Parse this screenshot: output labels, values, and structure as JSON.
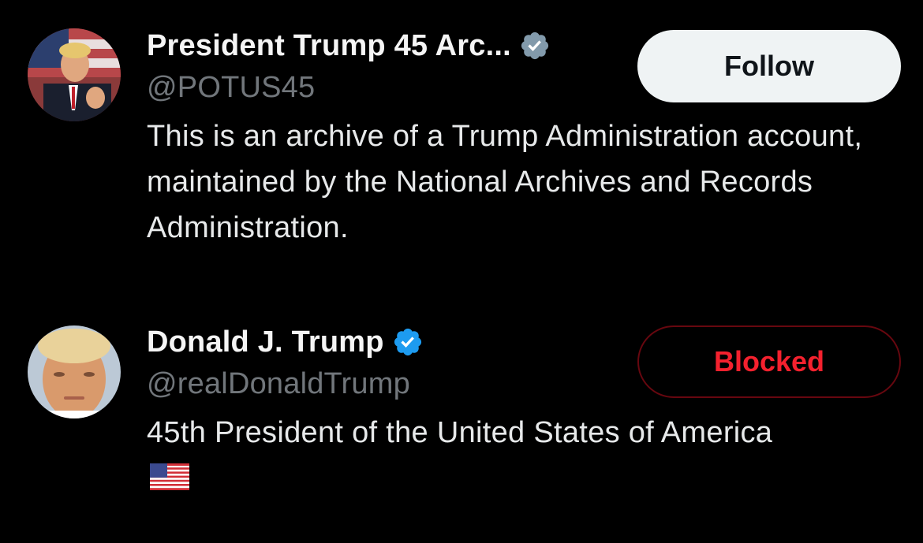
{
  "users": [
    {
      "display_name": "President Trump 45 Arc...",
      "handle": "@POTUS45",
      "bio": "This is an archive of a Trump Administration account, maintained by the National Archives and Records Administration.",
      "badge": {
        "icon": "verified-gray-badge-icon",
        "color": "#829aab"
      },
      "button": {
        "label": "Follow",
        "state": "not-following"
      }
    },
    {
      "display_name": "Donald J. Trump",
      "handle": "@realDonaldTrump",
      "bio": "45th President of the United States of America",
      "bio_emoji": {
        "icon": "us-flag-emoji-icon"
      },
      "badge": {
        "icon": "verified-blue-badge-icon",
        "color": "#1d9bf0"
      },
      "button": {
        "label": "Blocked",
        "state": "blocked"
      }
    }
  ],
  "colors": {
    "background": "#000000",
    "primary_text": "#e7e9ea",
    "secondary_text": "#71767b",
    "blocked_red": "#f4212e"
  }
}
